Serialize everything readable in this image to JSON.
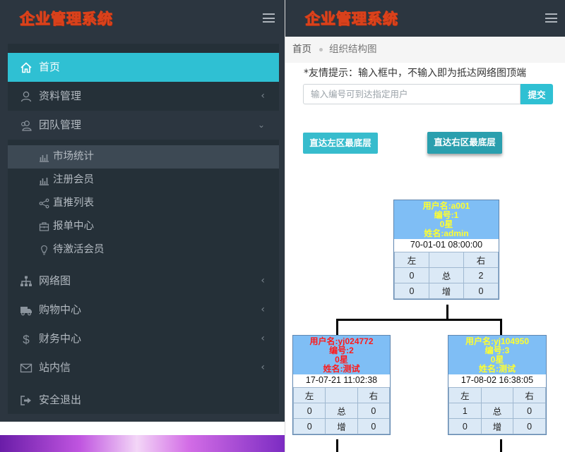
{
  "app": {
    "logo": "企业管理系统"
  },
  "sidebar": {
    "items": [
      {
        "label": "首页",
        "icon": "home-icon"
      },
      {
        "label": "资料管理",
        "icon": "user-icon"
      },
      {
        "label": "团队管理",
        "icon": "team-icon"
      },
      {
        "label": "网络图",
        "icon": "sitemap-icon"
      },
      {
        "label": "购物中心",
        "icon": "truck-icon"
      },
      {
        "label": "财务中心",
        "icon": "dollar-icon"
      },
      {
        "label": "站内信",
        "icon": "mail-icon"
      },
      {
        "label": "安全退出",
        "icon": "logout-icon"
      }
    ],
    "team_sub": [
      {
        "label": "市场统计",
        "icon": "bar-chart-icon"
      },
      {
        "label": "注册会员",
        "icon": "bar-chart-icon"
      },
      {
        "label": "直推列表",
        "icon": "share-icon"
      },
      {
        "label": "报单中心",
        "icon": "briefcase-icon"
      },
      {
        "label": "待激活会员",
        "icon": "lightbulb-icon"
      }
    ]
  },
  "breadcrumb": {
    "home": "首页",
    "current": "组织结构图"
  },
  "tip": "*友情提示：输入框中，不输入即为抵达网络图顶端",
  "search": {
    "placeholder": "输入编号可到达指定用户",
    "submit": "提交"
  },
  "buttons": {
    "left": "直达左区最底层",
    "right": "直达右区最底层"
  },
  "table_labels": {
    "left": "左",
    "right": "右",
    "total": "总",
    "add": "增"
  },
  "nodes": {
    "root": {
      "username": "用户名:a001",
      "id": "编号:1",
      "star": "0星",
      "name": "姓名:admin",
      "time": "70-01-01 08:00:00",
      "total_l": "0",
      "total_r": "2",
      "add_l": "0",
      "add_r": "0"
    },
    "left": {
      "username": "用户名:yj024772",
      "id": "编号:2",
      "star": "0星",
      "name": "姓名:测试",
      "time": "17-07-21 11:02:38",
      "total_l": "0",
      "total_r": "0",
      "add_l": "0",
      "add_r": "0"
    },
    "right": {
      "username": "用户名:yj104950",
      "id": "编号:3",
      "star": "0星",
      "name": "姓名:测试",
      "time": "17-08-02 16:38:05",
      "total_l": "1",
      "total_r": "0",
      "add_l": "0",
      "add_r": "0"
    }
  }
}
